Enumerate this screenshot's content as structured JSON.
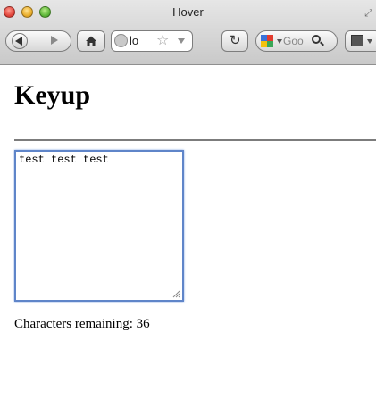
{
  "window": {
    "title": "Hover"
  },
  "toolbar": {
    "url_text": "lo",
    "search_placeholder": "Goo",
    "icons": {
      "back": "back-arrow-icon",
      "forward": "forward-arrow-icon",
      "home": "home-icon",
      "site": "globe-icon",
      "bookmark": "star-icon",
      "reload": "reload-icon",
      "search_engine": "google-logo-icon",
      "search": "magnifier-icon",
      "extra": "bookmarks-icon"
    }
  },
  "page": {
    "heading": "Keyup",
    "textarea_value": "test test test",
    "counter_text": "Characters remaining: 36"
  },
  "colors": {
    "focus_ring": "#5f85c9",
    "rule": "#7c7c7c",
    "chrome": "#d6d6d6"
  }
}
